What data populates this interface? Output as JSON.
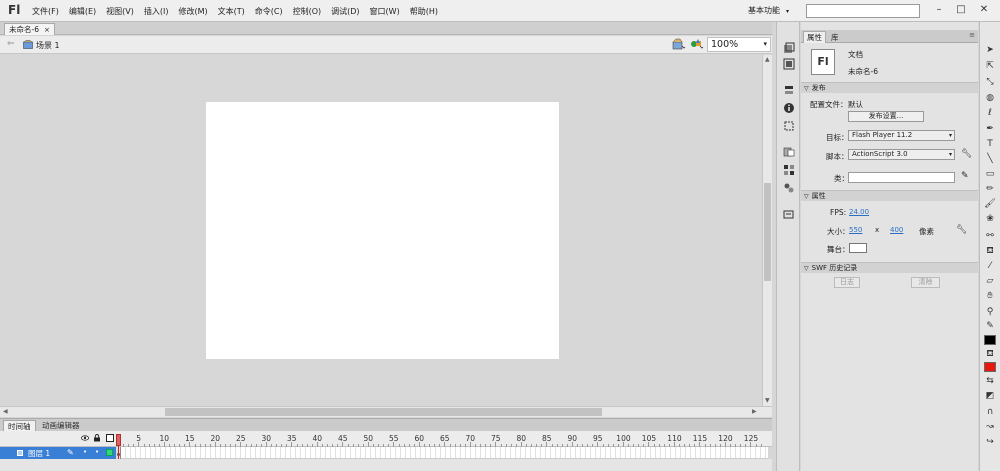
{
  "app": {
    "logo": "Fl"
  },
  "menubar": {
    "items": [
      "文件(F)",
      "编辑(E)",
      "视图(V)",
      "插入(I)",
      "修改(M)",
      "文本(T)",
      "命令(C)",
      "控制(O)",
      "调试(D)",
      "窗口(W)",
      "帮助(H)"
    ],
    "workspace": "基本功能",
    "search_placeholder": ""
  },
  "document": {
    "tab_label": "未命名-6",
    "tab_close": "×"
  },
  "editbar": {
    "scene_label": "场景 1",
    "zoom": "100%"
  },
  "timeline": {
    "tabs": [
      "时间轴",
      "动画编辑器"
    ],
    "layer_name": "图层 1",
    "frame_numbers": [
      "1",
      "5",
      "10",
      "15",
      "20",
      "25",
      "30",
      "35",
      "40",
      "45",
      "50",
      "55",
      "60",
      "65",
      "70",
      "75",
      "80",
      "85",
      "90",
      "95",
      "100",
      "105",
      "110",
      "115",
      "120",
      "125"
    ]
  },
  "properties": {
    "tabs": [
      "属性",
      "库"
    ],
    "doc_icon": "Fl",
    "doc_type": "文档",
    "doc_name": "未命名-6",
    "publish_section": "发布",
    "profile_label": "配置文件：",
    "profile_value": "默认",
    "publish_settings_button": "发布设置...",
    "target_label": "目标：",
    "target_value": "Flash Player 11.2",
    "script_label": "脚本：",
    "script_value": "ActionScript 3.0",
    "class_label": "类：",
    "class_value": "",
    "props_section": "属性",
    "fps_label": "FPS:",
    "fps_value": "24.00",
    "size_label": "大小：",
    "size_width": "550",
    "size_x": "x",
    "size_height": "400",
    "size_unit": "像素",
    "stage_label": "舞台：",
    "swf_section": "SWF 历史记录",
    "log_button": "日志",
    "clear_button": "清除"
  },
  "colors": {
    "stroke": "#000000",
    "fill": "#e8160c",
    "selected_layer": "#3a7fd6"
  }
}
